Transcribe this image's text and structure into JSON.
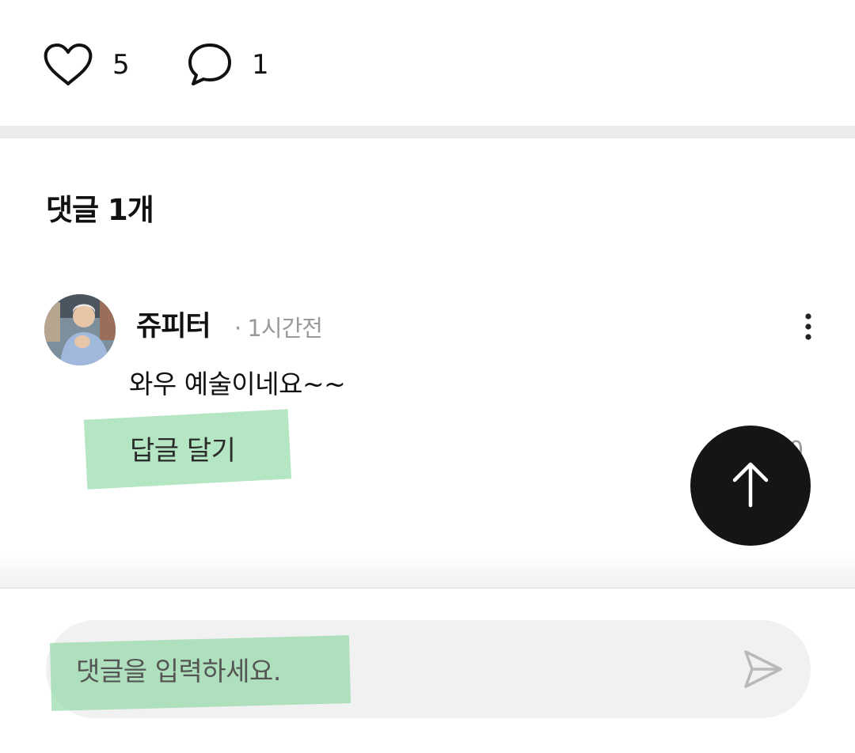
{
  "reactions": {
    "like_count": "5",
    "comment_count": "1"
  },
  "comments_section": {
    "title": "댓글 1개"
  },
  "comment": {
    "author": "쥬피터",
    "time": "· 1시간전",
    "text": "와우 예술이네요~~",
    "reply_label": "답글 달기",
    "like_count_partial": "0"
  },
  "input": {
    "placeholder": "댓글을 입력하세요."
  },
  "icons": {
    "like": "heart-icon",
    "comment": "speech-bubble-icon",
    "more": "vertical-dots-icon",
    "scroll_top": "arrow-up-icon",
    "send": "send-icon"
  },
  "colors": {
    "highlight": "#78d291",
    "scroll_button": "#151515",
    "divider": "#ebebeb",
    "input_background": "#f1f1f1",
    "muted_text": "#9a9a9a"
  }
}
